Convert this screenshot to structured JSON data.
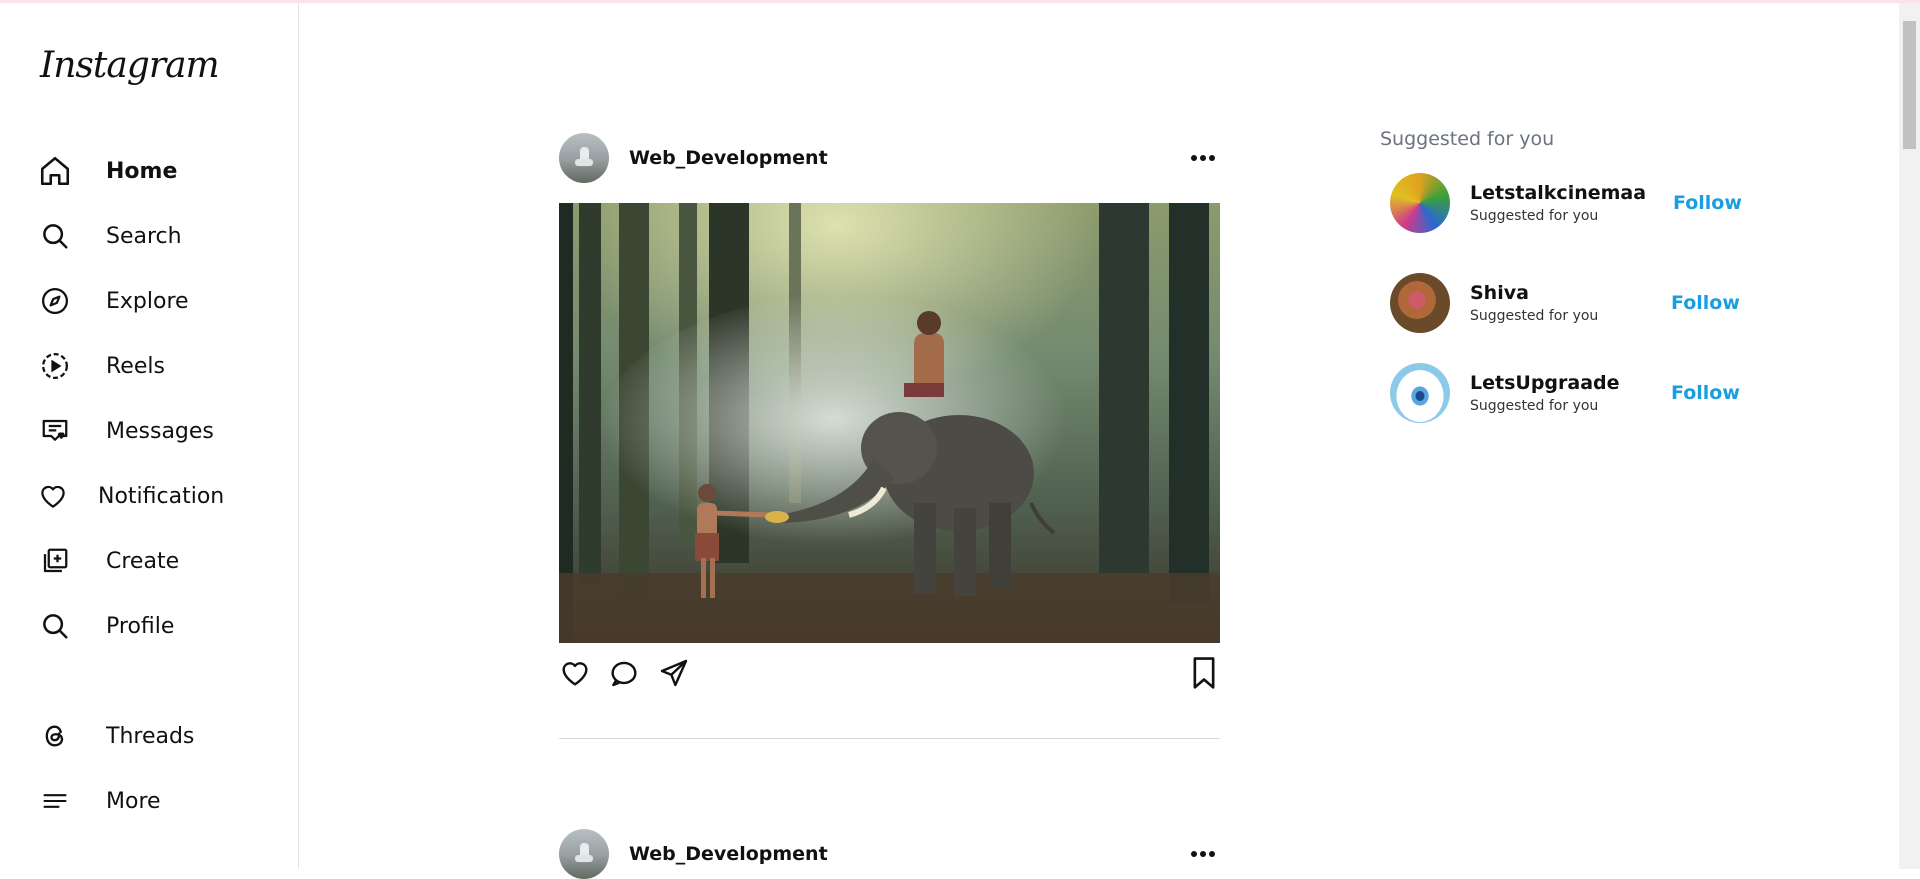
{
  "app": {
    "logo": "Instagram"
  },
  "sidebar": {
    "items": [
      {
        "label": "Home",
        "icon": "home-icon"
      },
      {
        "label": "Search",
        "icon": "search-icon"
      },
      {
        "label": "Explore",
        "icon": "compass-icon"
      },
      {
        "label": "Reels",
        "icon": "reels-icon"
      },
      {
        "label": "Messages",
        "icon": "messages-icon"
      },
      {
        "label": "Notification",
        "icon": "heart-icon"
      },
      {
        "label": "Create",
        "icon": "create-icon"
      },
      {
        "label": "Profile",
        "icon": "search-icon"
      },
      {
        "label": "Threads",
        "icon": "threads-icon"
      },
      {
        "label": "More",
        "icon": "menu-icon"
      }
    ]
  },
  "feed": {
    "posts": [
      {
        "username": "Web_Development"
      },
      {
        "username": "Web_Development"
      }
    ]
  },
  "suggestions": {
    "title": "Suggested for you",
    "follow_label": "Follow",
    "users": [
      {
        "name": "Letstalkcinemaa",
        "subtitle": "Suggested for you"
      },
      {
        "name": "Shiva",
        "subtitle": "Suggested for you"
      },
      {
        "name": "LetsUpgraade",
        "subtitle": "Suggested for you"
      }
    ]
  },
  "colors": {
    "accent": "#1a9ee0",
    "muted": "#6b7280",
    "border": "#e4e4e4"
  }
}
